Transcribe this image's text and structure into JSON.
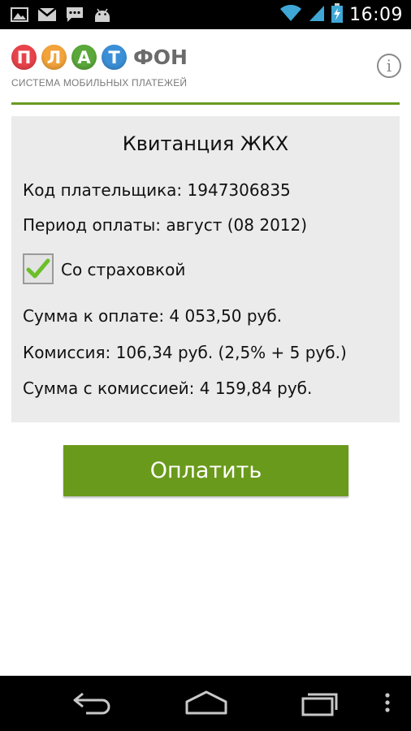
{
  "status_bar": {
    "time": "16:09",
    "left_icons": [
      "gallery-icon",
      "gmail-icon",
      "message-icon",
      "android-icon"
    ],
    "right_icons": [
      "wifi-icon",
      "signal-icon",
      "battery-charging-icon"
    ]
  },
  "header": {
    "logo_letters": [
      {
        "char": "П",
        "color": "#e8434b"
      },
      {
        "char": "Л",
        "color": "#f2a33a"
      },
      {
        "char": "А",
        "color": "#5aa83a"
      },
      {
        "char": "Т",
        "color": "#3b8fd6"
      }
    ],
    "logo_rest": "ФОН",
    "logo_subtitle": "СИСТЕМА МОБИЛЬНЫХ ПЛАТЕЖЕЙ",
    "info_glyph": "i"
  },
  "receipt": {
    "title": "Квитанция ЖКХ",
    "payer_code": "Код плательщика: 1947306835",
    "period": "Период оплаты: август (08 2012)",
    "insurance_label": "Со страховкой",
    "insurance_checked": true,
    "amount": "Сумма к оплате: 4 053,50 руб.",
    "commission": "Комиссия: 106,34 руб. (2,5% + 5 руб.)",
    "total": "Сумма с комиссией: 4 159,84 руб."
  },
  "pay_button": {
    "label": "Оплатить"
  },
  "nav_bar": {
    "items": [
      "back-icon",
      "home-icon",
      "recent-apps-icon",
      "menu-icon"
    ]
  },
  "colors": {
    "accent": "#6a9a1b",
    "card_bg": "#ebebeb",
    "checkmark": "#6cbf2a"
  }
}
